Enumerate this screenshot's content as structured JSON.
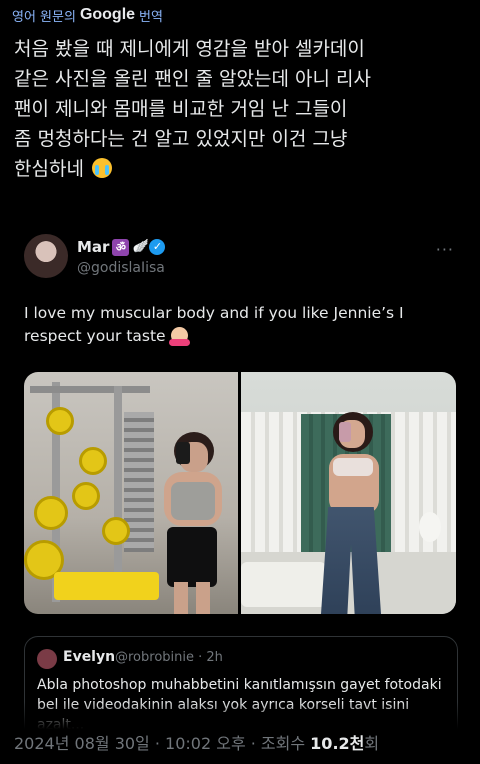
{
  "translation": {
    "prefix": "영어 원문의",
    "brand": "Google",
    "suffix": "번역"
  },
  "tweet": {
    "text": "처음 봤을 때 제니에게 영감을 받아 셀카데이\n같은 사진을 올린 팬인 줄 알았는데 아니 리사\n팬이 제니와 몸매를 비교한 거임 난 그들이\n좀 멍청하다는 건 알고 있었지만 이건 그냥\n한심하네"
  },
  "quote": {
    "name": "Mar",
    "handle": "@godislaIisa",
    "more": "···",
    "text": "I love my muscular body and if you like Jennie’s I respect your taste"
  },
  "nested_quote": {
    "name": "Evelyn",
    "handle": "@robrobinie · 2h",
    "text": "Abla photoshop muhabbetini kanıtlamışsın gayet fotodaki bel ile videodakinin alaksı yok ayrıca korseli tavt isini azalt..."
  },
  "meta": {
    "timestamp": "2024년 08월 30일 · 10:02 오후 · 조회수 ",
    "views": "10.2천",
    "views_suffix": "회"
  },
  "colors": {
    "background": "#000000",
    "link": "#8ab4f8",
    "muted": "#71767b",
    "verified": "#1d9bf0"
  }
}
